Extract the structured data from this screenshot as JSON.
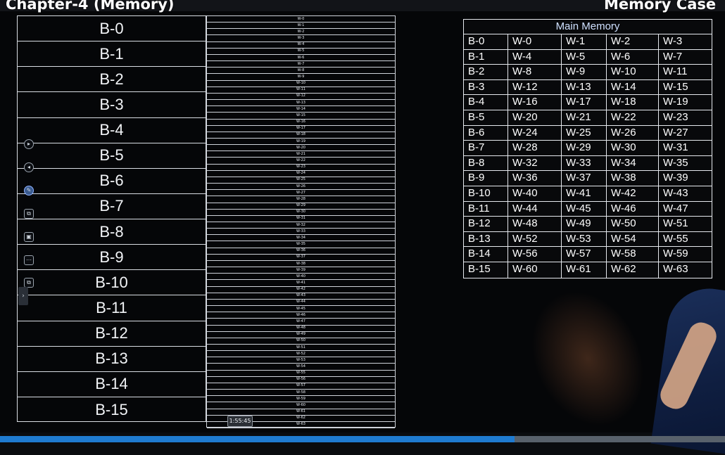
{
  "header": {
    "chapter_title": "Chapter-4 (Memory)",
    "case_title": "Memory Case"
  },
  "blocks": [
    "B-0",
    "B-1",
    "B-2",
    "B-3",
    "B-4",
    "B-5",
    "B-6",
    "B-7",
    "B-8",
    "B-9",
    "B-10",
    "B-11",
    "B-12",
    "B-13",
    "B-14",
    "B-15"
  ],
  "words": [
    "W-0",
    "W-1",
    "W-2",
    "W-3",
    "W-4",
    "W-5",
    "W-6",
    "W-7",
    "W-8",
    "W-9",
    "W-10",
    "W-11",
    "W-12",
    "W-13",
    "W-14",
    "W-15",
    "W-16",
    "W-17",
    "W-18",
    "W-19",
    "W-20",
    "W-21",
    "W-22",
    "W-23",
    "W-24",
    "W-25",
    "W-26",
    "W-27",
    "W-28",
    "W-29",
    "W-30",
    "W-31",
    "W-32",
    "W-33",
    "W-34",
    "W-35",
    "W-36",
    "W-37",
    "W-38",
    "W-39",
    "W-40",
    "W-41",
    "W-42",
    "W-43",
    "W-44",
    "W-45",
    "W-46",
    "W-47",
    "W-48",
    "W-49",
    "W-50",
    "W-51",
    "W-52",
    "W-53",
    "W-54",
    "W-55",
    "W-56",
    "W-57",
    "W-58",
    "W-59",
    "W-60",
    "W-61",
    "W-62",
    "W-63"
  ],
  "main_memory": {
    "title": "Main Memory",
    "rows": [
      [
        "B-0",
        "W-0",
        "W-1",
        "W-2",
        "W-3"
      ],
      [
        "B-1",
        "W-4",
        "W-5",
        "W-6",
        "W-7"
      ],
      [
        "B-2",
        "W-8",
        "W-9",
        "W-10",
        "W-11"
      ],
      [
        "B-3",
        "W-12",
        "W-13",
        "W-14",
        "W-15"
      ],
      [
        "B-4",
        "W-16",
        "W-17",
        "W-18",
        "W-19"
      ],
      [
        "B-5",
        "W-20",
        "W-21",
        "W-22",
        "W-23"
      ],
      [
        "B-6",
        "W-24",
        "W-25",
        "W-26",
        "W-27"
      ],
      [
        "B-7",
        "W-28",
        "W-29",
        "W-30",
        "W-31"
      ],
      [
        "B-8",
        "W-32",
        "W-33",
        "W-34",
        "W-35"
      ],
      [
        "B-9",
        "W-36",
        "W-37",
        "W-38",
        "W-39"
      ],
      [
        "B-10",
        "W-40",
        "W-41",
        "W-42",
        "W-43"
      ],
      [
        "B-11",
        "W-44",
        "W-45",
        "W-46",
        "W-47"
      ],
      [
        "B-12",
        "W-48",
        "W-49",
        "W-50",
        "W-51"
      ],
      [
        "B-13",
        "W-52",
        "W-53",
        "W-54",
        "W-55"
      ],
      [
        "B-14",
        "W-56",
        "W-57",
        "W-58",
        "W-59"
      ],
      [
        "B-15",
        "W-60",
        "W-61",
        "W-62",
        "W-63"
      ]
    ]
  },
  "tools": [
    {
      "icon": "play-circle-icon",
      "glyph": "▸"
    },
    {
      "icon": "back-circle-icon",
      "glyph": "◂"
    },
    {
      "icon": "pen-icon",
      "glyph": "✎"
    },
    {
      "icon": "copy-icon",
      "glyph": "⧉"
    },
    {
      "icon": "image-icon",
      "glyph": "▣"
    },
    {
      "icon": "more-icon",
      "glyph": "⋯"
    },
    {
      "icon": "screen-share-icon",
      "glyph": "⧉"
    }
  ],
  "side_handle": {
    "icon": "chevron-right-icon",
    "glyph": "›"
  },
  "player": {
    "time_tooltip": "1:55:45",
    "progress": 0.71,
    "accent_color": "#1f7bd1"
  }
}
